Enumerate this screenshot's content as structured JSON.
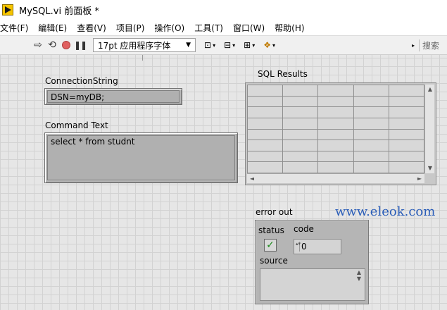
{
  "window": {
    "title": "MySQL.vi 前面板 *"
  },
  "menu": [
    "文件(F)",
    "编辑(E)",
    "查看(V)",
    "项目(P)",
    "操作(O)",
    "工具(T)",
    "窗口(W)",
    "帮助(H)"
  ],
  "toolbar": {
    "run_icon": "⇨",
    "run_continuous_icon": "⟲",
    "pause_icon": "❚❚",
    "font_value": "17pt 应用程序字体",
    "font_arrow": "▼",
    "align_icon": "⊡",
    "distribute_icon": "⊟",
    "resize_icon": "⊞",
    "reorder_icon": "❖",
    "dropdown": "▾",
    "right_arrow": "▸",
    "search_placeholder": "搜索"
  },
  "panel": {
    "connection_label": "ConnectionString",
    "connection_value": "DSN=myDB;",
    "command_label": "Command Text",
    "command_value": "select * from studnt",
    "results_label": "SQL Results",
    "table_rows": 8,
    "table_cols": 5,
    "scroll_up": "▲",
    "scroll_down": "▼",
    "scroll_left": "◄",
    "scroll_right": "►",
    "error_label": "error out",
    "status_label": "status",
    "status_check": "✓",
    "code_label": "code",
    "code_value": "0",
    "code_inc": "▴▾",
    "source_label": "source",
    "source_scroll": "▲ ▼"
  },
  "watermark": "www.eleok.com"
}
